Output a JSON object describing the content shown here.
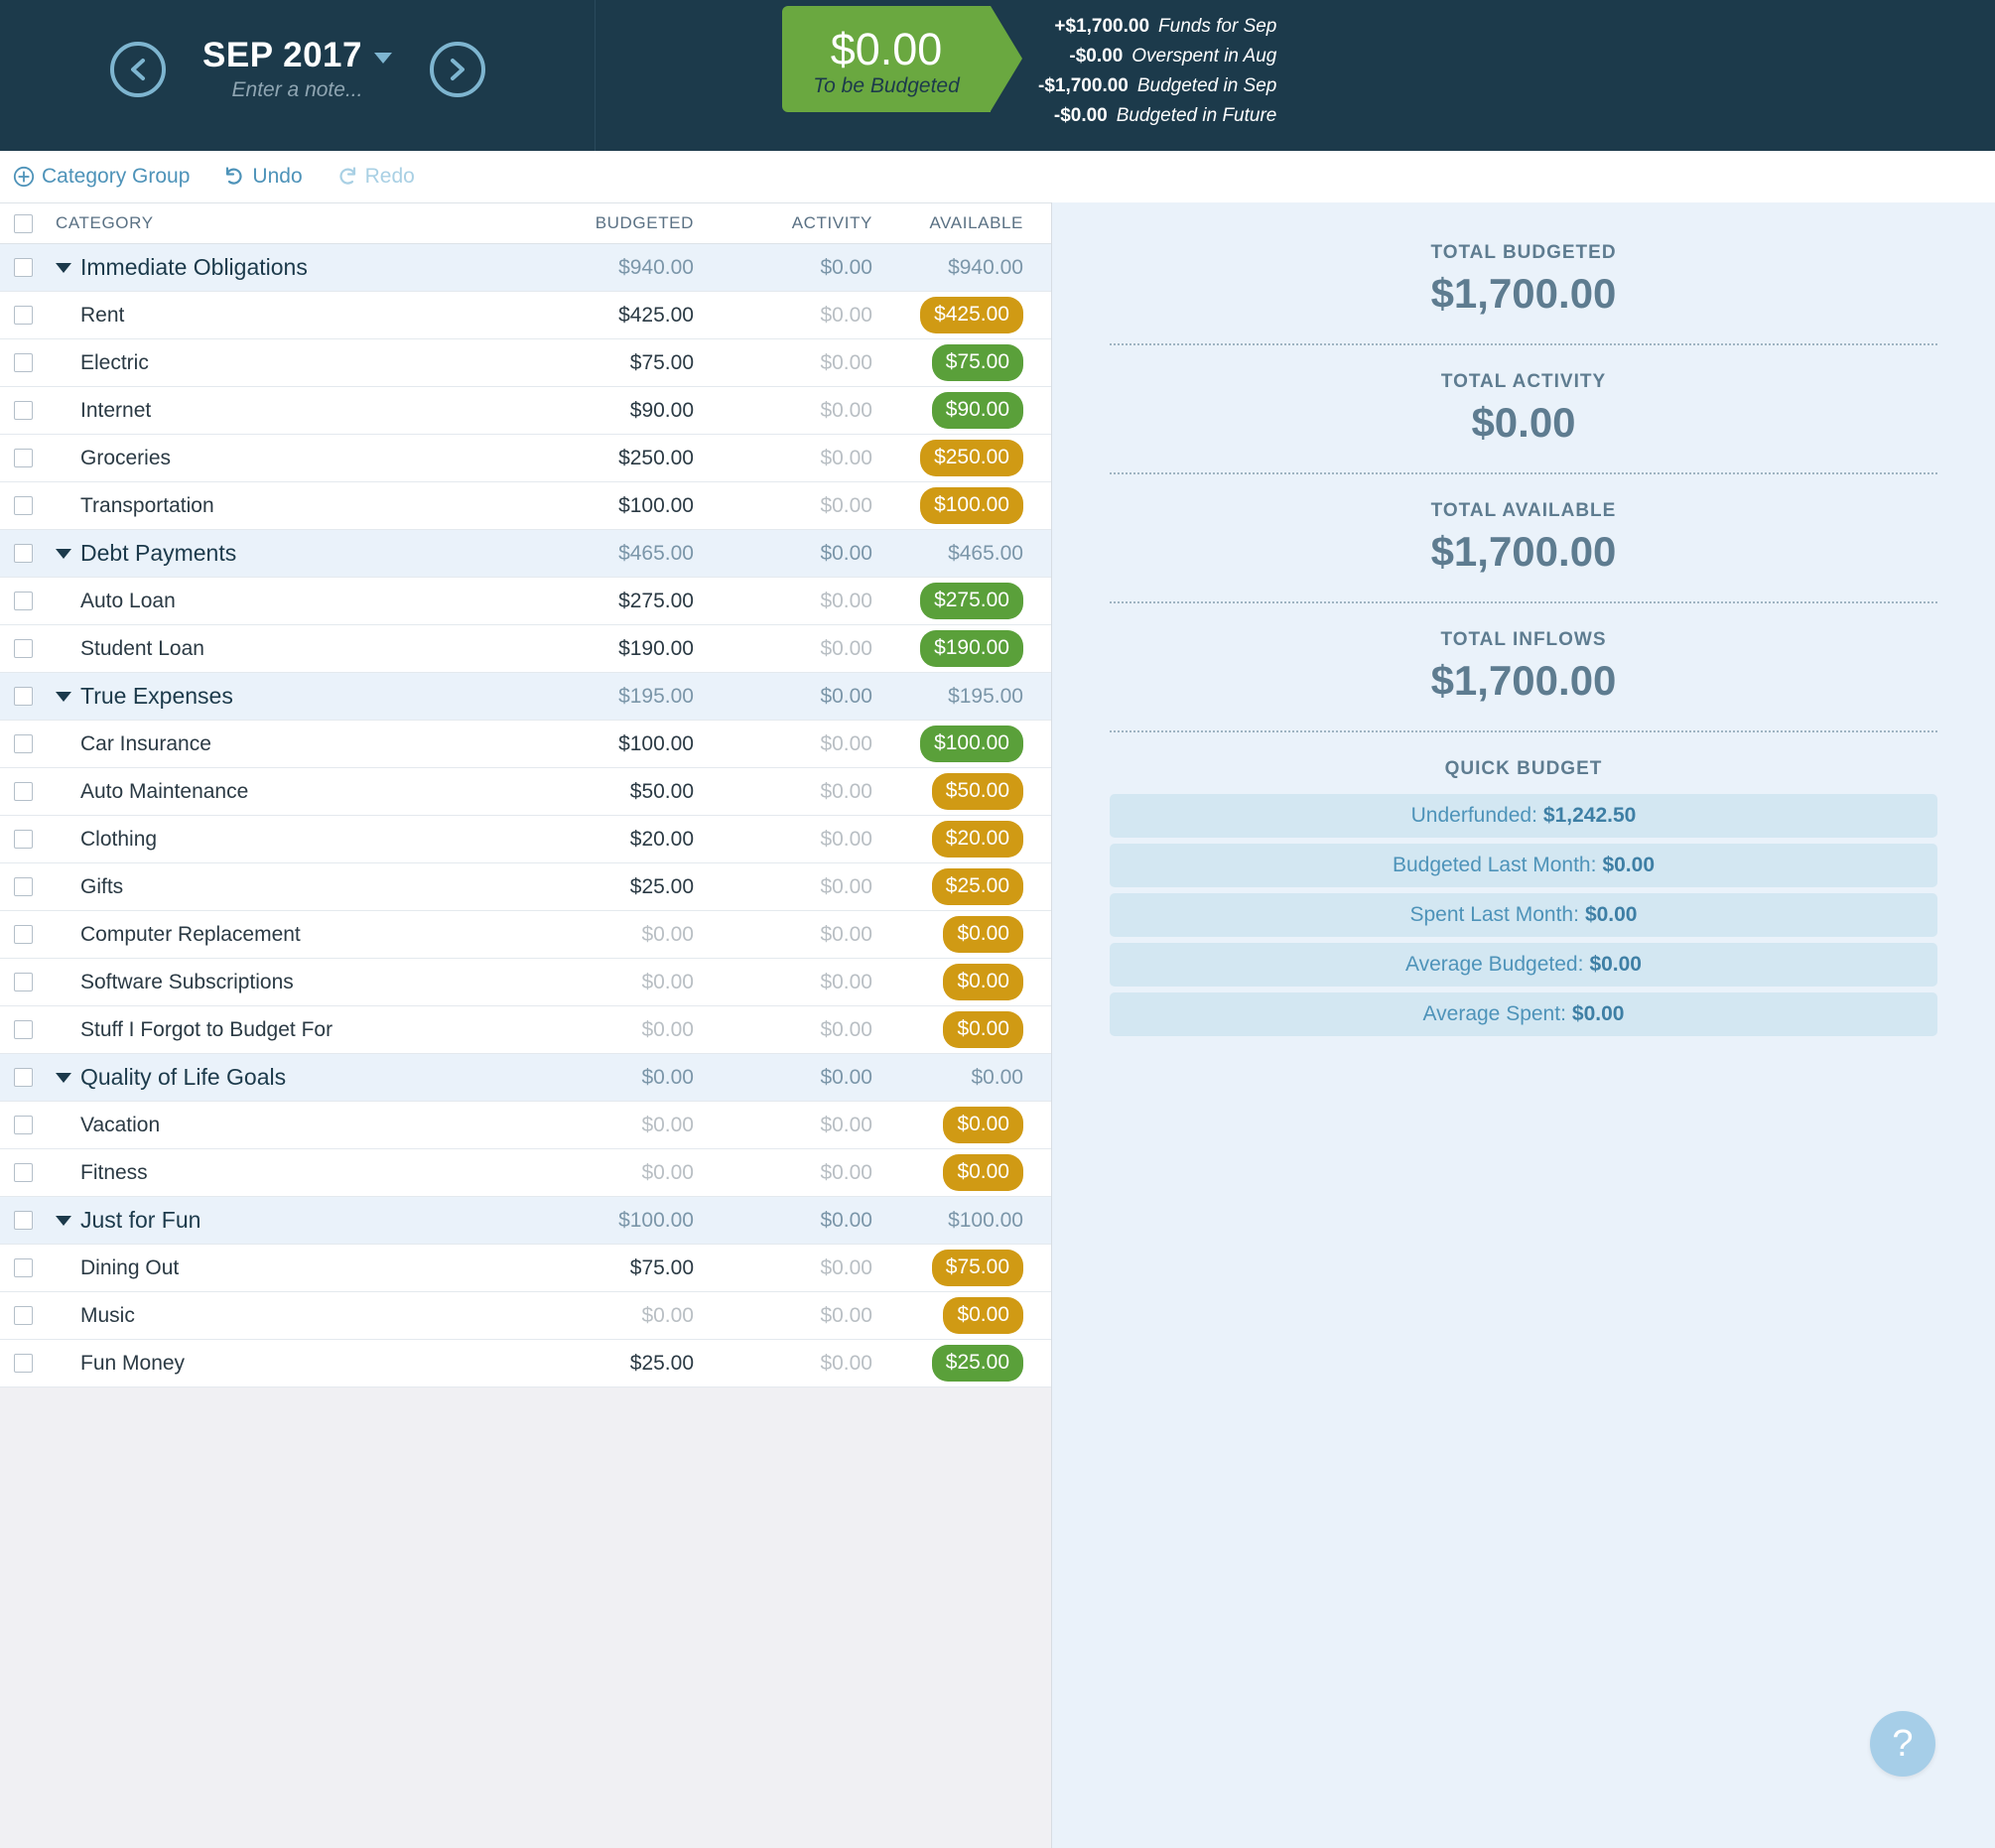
{
  "header": {
    "prev_icon": "chevron-left-icon",
    "next_icon": "chevron-right-icon",
    "month": "SEP 2017",
    "note_placeholder": "Enter a note...",
    "to_be_budgeted_amount": "$0.00",
    "to_be_budgeted_label": "To be Budgeted",
    "accent_green": "#6aa840",
    "breakdown": [
      {
        "amount": "+$1,700.00",
        "label": "Funds for Sep"
      },
      {
        "amount": "-$0.00",
        "label": "Overspent in Aug"
      },
      {
        "amount": "-$1,700.00",
        "label": "Budgeted in Sep"
      },
      {
        "amount": "-$0.00",
        "label": "Budgeted in Future"
      }
    ]
  },
  "toolbar": {
    "category_group": "Category Group",
    "category_group_icon": "plus-circle-icon",
    "undo": "Undo",
    "undo_icon": "undo-arrow-icon",
    "redo": "Redo",
    "redo_icon": "redo-arrow-icon"
  },
  "table": {
    "columns": {
      "category": "CATEGORY",
      "budgeted": "BUDGETED",
      "activity": "ACTIVITY",
      "available": "AVAILABLE"
    },
    "rows": [
      {
        "type": "group",
        "name": "Immediate Obligations",
        "budgeted": "$940.00",
        "activity": "$0.00",
        "available": "$940.00"
      },
      {
        "type": "category",
        "name": "Rent",
        "budgeted": "$425.00",
        "activity": "$0.00",
        "available": "$425.00",
        "pill": "gold"
      },
      {
        "type": "category",
        "name": "Electric",
        "budgeted": "$75.00",
        "activity": "$0.00",
        "available": "$75.00",
        "pill": "green"
      },
      {
        "type": "category",
        "name": "Internet",
        "budgeted": "$90.00",
        "activity": "$0.00",
        "available": "$90.00",
        "pill": "green"
      },
      {
        "type": "category",
        "name": "Groceries",
        "budgeted": "$250.00",
        "activity": "$0.00",
        "available": "$250.00",
        "pill": "gold"
      },
      {
        "type": "category",
        "name": "Transportation",
        "budgeted": "$100.00",
        "activity": "$0.00",
        "available": "$100.00",
        "pill": "gold"
      },
      {
        "type": "group",
        "name": "Debt Payments",
        "budgeted": "$465.00",
        "activity": "$0.00",
        "available": "$465.00"
      },
      {
        "type": "category",
        "name": "Auto Loan",
        "budgeted": "$275.00",
        "activity": "$0.00",
        "available": "$275.00",
        "pill": "green"
      },
      {
        "type": "category",
        "name": "Student Loan",
        "budgeted": "$190.00",
        "activity": "$0.00",
        "available": "$190.00",
        "pill": "green"
      },
      {
        "type": "group",
        "name": "True Expenses",
        "budgeted": "$195.00",
        "activity": "$0.00",
        "available": "$195.00"
      },
      {
        "type": "category",
        "name": "Car Insurance",
        "budgeted": "$100.00",
        "activity": "$0.00",
        "available": "$100.00",
        "pill": "green"
      },
      {
        "type": "category",
        "name": "Auto Maintenance",
        "budgeted": "$50.00",
        "activity": "$0.00",
        "available": "$50.00",
        "pill": "gold"
      },
      {
        "type": "category",
        "name": "Clothing",
        "budgeted": "$20.00",
        "activity": "$0.00",
        "available": "$20.00",
        "pill": "gold"
      },
      {
        "type": "category",
        "name": "Gifts",
        "budgeted": "$25.00",
        "activity": "$0.00",
        "available": "$25.00",
        "pill": "gold"
      },
      {
        "type": "category",
        "name": "Computer Replacement",
        "budgeted": "$0.00",
        "activity": "$0.00",
        "available": "$0.00",
        "pill": "gold",
        "budgeted_muted": true
      },
      {
        "type": "category",
        "name": "Software Subscriptions",
        "budgeted": "$0.00",
        "activity": "$0.00",
        "available": "$0.00",
        "pill": "gold",
        "budgeted_muted": true
      },
      {
        "type": "category",
        "name": "Stuff I Forgot to Budget For",
        "budgeted": "$0.00",
        "activity": "$0.00",
        "available": "$0.00",
        "pill": "gold",
        "budgeted_muted": true
      },
      {
        "type": "group",
        "name": "Quality of Life Goals",
        "budgeted": "$0.00",
        "activity": "$0.00",
        "available": "$0.00"
      },
      {
        "type": "category",
        "name": "Vacation",
        "budgeted": "$0.00",
        "activity": "$0.00",
        "available": "$0.00",
        "pill": "gold",
        "budgeted_muted": true
      },
      {
        "type": "category",
        "name": "Fitness",
        "budgeted": "$0.00",
        "activity": "$0.00",
        "available": "$0.00",
        "pill": "gold",
        "budgeted_muted": true
      },
      {
        "type": "group",
        "name": "Just for Fun",
        "budgeted": "$100.00",
        "activity": "$0.00",
        "available": "$100.00"
      },
      {
        "type": "category",
        "name": "Dining Out",
        "budgeted": "$75.00",
        "activity": "$0.00",
        "available": "$75.00",
        "pill": "gold"
      },
      {
        "type": "category",
        "name": "Music",
        "budgeted": "$0.00",
        "activity": "$0.00",
        "available": "$0.00",
        "pill": "gold",
        "budgeted_muted": true
      },
      {
        "type": "category",
        "name": "Fun Money",
        "budgeted": "$25.00",
        "activity": "$0.00",
        "available": "$25.00",
        "pill": "green"
      }
    ]
  },
  "sidebar": {
    "totals": [
      {
        "label": "TOTAL BUDGETED",
        "value": "$1,700.00"
      },
      {
        "label": "TOTAL ACTIVITY",
        "value": "$0.00"
      },
      {
        "label": "TOTAL AVAILABLE",
        "value": "$1,700.00"
      },
      {
        "label": "TOTAL INFLOWS",
        "value": "$1,700.00"
      }
    ],
    "quick_budget_title": "QUICK BUDGET",
    "quick_budget": [
      {
        "label": "Underfunded:",
        "value": "$1,242.50"
      },
      {
        "label": "Budgeted Last Month:",
        "value": "$0.00"
      },
      {
        "label": "Spent Last Month:",
        "value": "$0.00"
      },
      {
        "label": "Average Budgeted:",
        "value": "$0.00"
      },
      {
        "label": "Average Spent:",
        "value": "$0.00"
      }
    ],
    "help_icon": "question-mark-icon",
    "help_label": "?"
  }
}
